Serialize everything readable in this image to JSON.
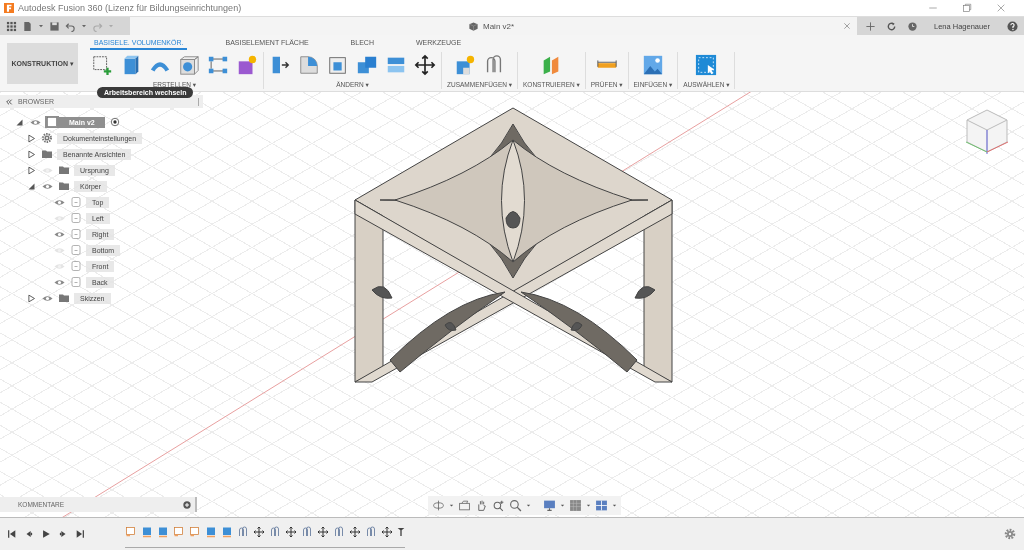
{
  "window": {
    "title": "Autodesk Fusion 360 (Lizenz für Bildungseinrichtungen)"
  },
  "app_bar": {
    "document_tab": {
      "title": "Main v2*"
    },
    "user": "Lena Hagenauer"
  },
  "ribbon": {
    "workspace": "KONSTRUKTION ▾",
    "tabs": [
      {
        "label": "BASISELE. VOLUMENKÖR.",
        "selected": true
      },
      {
        "label": "BASISELEMENT FLÄCHE",
        "selected": false
      },
      {
        "label": "BLECH",
        "selected": false
      },
      {
        "label": "WERKZEUGE",
        "selected": false
      }
    ],
    "groups": [
      {
        "label": "ERSTELLEN ▾"
      },
      {
        "label": "ÄNDERN ▾"
      },
      {
        "label": "ZUSAMMENFÜGEN ▾"
      },
      {
        "label": "KONSTRUIEREN ▾"
      },
      {
        "label": "PRÜFEN ▾"
      },
      {
        "label": "EINFÜGEN ▾"
      },
      {
        "label": "AUSWÄHLEN ▾"
      }
    ]
  },
  "tooltip": "Arbeitsbereich wechseln",
  "browser": {
    "title": "BROWSER",
    "tree": [
      {
        "label": "Main v2",
        "kind": "component",
        "expanded": true,
        "visible": true,
        "active": true,
        "children": [
          {
            "label": "Dokumenteinstellungen",
            "kind": "settings",
            "expanded": false
          },
          {
            "label": "Benannte Ansichten",
            "kind": "folder",
            "expanded": false
          },
          {
            "label": "Ursprung",
            "kind": "folder",
            "expanded": false,
            "visible": false
          },
          {
            "label": "Körper",
            "kind": "folder",
            "expanded": true,
            "visible": true,
            "children": [
              {
                "label": "Top",
                "kind": "body",
                "visible": true
              },
              {
                "label": "Left",
                "kind": "body",
                "visible": false
              },
              {
                "label": "Right",
                "kind": "body",
                "visible": true
              },
              {
                "label": "Bottom",
                "kind": "body",
                "visible": false
              },
              {
                "label": "Front",
                "kind": "body",
                "visible": false
              },
              {
                "label": "Back",
                "kind": "body",
                "visible": true
              }
            ]
          },
          {
            "label": "Skizzen",
            "kind": "folder",
            "expanded": false,
            "visible": true
          }
        ]
      }
    ]
  },
  "comments": {
    "title": "KOMMENTARE"
  },
  "timeline": {
    "items": [
      {
        "kind": "sketch"
      },
      {
        "kind": "extrude"
      },
      {
        "kind": "extrude"
      },
      {
        "kind": "sketch"
      },
      {
        "kind": "sketch"
      },
      {
        "kind": "extrude"
      },
      {
        "kind": "extrude"
      },
      {
        "kind": "joint"
      },
      {
        "kind": "move"
      },
      {
        "kind": "joint"
      },
      {
        "kind": "move"
      },
      {
        "kind": "joint"
      },
      {
        "kind": "move"
      },
      {
        "kind": "joint"
      },
      {
        "kind": "move"
      },
      {
        "kind": "joint"
      },
      {
        "kind": "move"
      }
    ]
  }
}
